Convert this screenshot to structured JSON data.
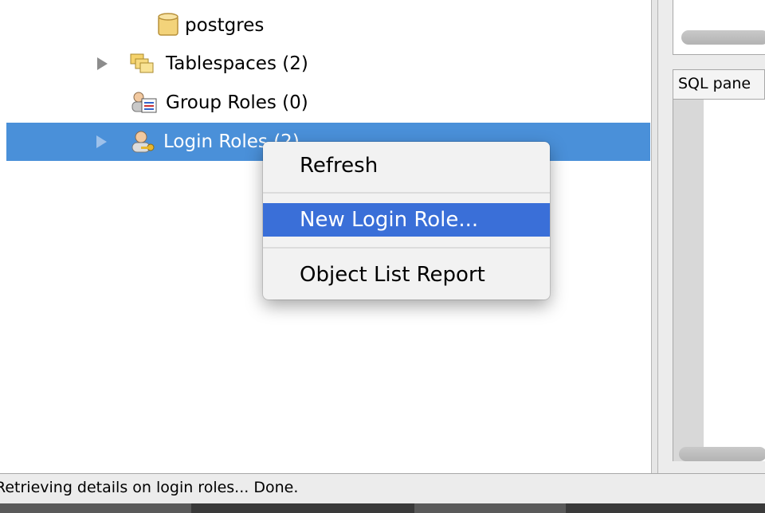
{
  "tree": {
    "items": [
      {
        "label": "postgres",
        "icon": "database-icon",
        "expandable": false
      },
      {
        "label": "Tablespaces (2)",
        "icon": "tablespaces-icon",
        "expandable": true
      },
      {
        "label": "Group Roles (0)",
        "icon": "group-roles-icon",
        "expandable": false
      },
      {
        "label": "Login Roles (2)",
        "icon": "login-roles-icon",
        "expandable": true,
        "selected": true
      }
    ]
  },
  "right_panel": {
    "sql_pane_label": "SQL pane"
  },
  "context_menu": {
    "items": [
      {
        "label": "Refresh"
      },
      {
        "label": "New Login Role...",
        "highlighted": true
      },
      {
        "label": "Object List Report"
      }
    ]
  },
  "status_bar": {
    "text": "Retrieving details on login roles... Done."
  },
  "colors": {
    "selection": "#4a90d9",
    "menu_highlight": "#3a6fd8"
  }
}
